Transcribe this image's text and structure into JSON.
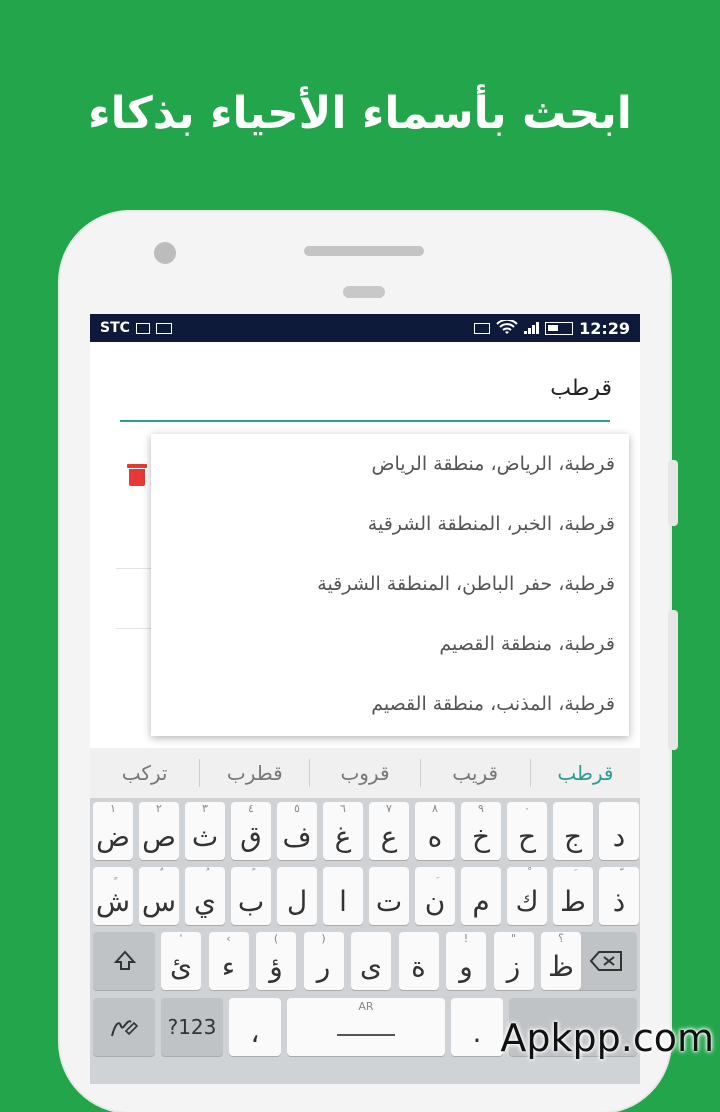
{
  "headline": "ابحث بأسماء الأحياء بذكاء",
  "status_bar": {
    "carrier": "STC",
    "time": "12:29"
  },
  "search": {
    "value": "قرطب"
  },
  "dropdown": {
    "items": [
      "قرطبة، الرياض، منطقة الرياض",
      "قرطبة، الخبر، المنطقة الشرقية",
      "قرطبة، حفر الباطن، المنطقة الشرقية",
      "قرطبة، منطقة القصيم",
      "قرطبة، المذنب، منطقة القصيم"
    ]
  },
  "suggestions": [
    "قرطب",
    "قريب",
    "قروب",
    "قطرب",
    "تركب"
  ],
  "keyboard": {
    "row1": [
      {
        "ch": "ض",
        "hint": "١"
      },
      {
        "ch": "ص",
        "hint": "٢"
      },
      {
        "ch": "ث",
        "hint": "٣"
      },
      {
        "ch": "ق",
        "hint": "٤"
      },
      {
        "ch": "ف",
        "hint": "٥"
      },
      {
        "ch": "غ",
        "hint": "٦"
      },
      {
        "ch": "ع",
        "hint": "٧"
      },
      {
        "ch": "ه",
        "hint": "٨"
      },
      {
        "ch": "خ",
        "hint": "٩"
      },
      {
        "ch": "ح",
        "hint": "٠"
      },
      {
        "ch": "ج",
        "hint": ""
      },
      {
        "ch": "د",
        "hint": ""
      }
    ],
    "row2": [
      {
        "ch": "ش",
        "hint": "ٍ"
      },
      {
        "ch": "س",
        "hint": "ٌ"
      },
      {
        "ch": "ي",
        "hint": "ُ"
      },
      {
        "ch": "ب",
        "hint": "ً"
      },
      {
        "ch": "ل",
        "hint": ""
      },
      {
        "ch": "ا",
        "hint": ""
      },
      {
        "ch": "ت",
        "hint": ""
      },
      {
        "ch": "ن",
        "hint": "ِ"
      },
      {
        "ch": "م",
        "hint": ""
      },
      {
        "ch": "ك",
        "hint": "ْ"
      },
      {
        "ch": "ط",
        "hint": "َ"
      },
      {
        "ch": "ذ",
        "hint": "ّ"
      }
    ],
    "row3": [
      {
        "ch": "ئ",
        "hint": "'"
      },
      {
        "ch": "ء",
        "hint": "‹"
      },
      {
        "ch": "ؤ",
        "hint": "("
      },
      {
        "ch": "ر",
        "hint": ")"
      },
      {
        "ch": "ى",
        "hint": ""
      },
      {
        "ch": "ة",
        "hint": ""
      },
      {
        "ch": "و",
        "hint": "!"
      },
      {
        "ch": "ز",
        "hint": "\""
      },
      {
        "ch": "ظ",
        "hint": "؟"
      }
    ],
    "numbers_label": "?123",
    "comma": "،",
    "space_hint": "AR",
    "period": ".",
    "icons": {
      "shift": "shift-icon",
      "backspace": "backspace-icon",
      "handwriting": "handwriting-icon",
      "enter": "enter-icon"
    }
  },
  "watermark": "Apkpp.com"
}
